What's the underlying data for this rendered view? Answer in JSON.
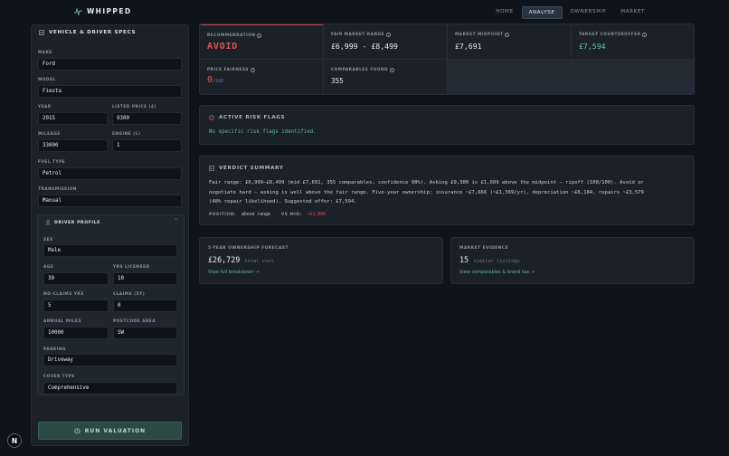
{
  "app": {
    "name": "WHIPPED"
  },
  "nav": [
    "HOME",
    "ANALYSE",
    "OWNERSHIP",
    "MARKET"
  ],
  "nav_active": "ANALYSE",
  "sidebar": {
    "title": "VEHICLE & DRIVER SPECS",
    "make": {
      "label": "MAKE",
      "value": "Ford"
    },
    "model": {
      "label": "MODEL",
      "value": "Fiesta"
    },
    "year": {
      "label": "YEAR",
      "value": "2015"
    },
    "listed_price": {
      "label": "LISTED PRICE (£)",
      "value": "9300"
    },
    "mileage": {
      "label": "MILEAGE",
      "value": "33000"
    },
    "engine": {
      "label": "ENGINE (L)",
      "value": "1"
    },
    "fuel_type": {
      "label": "FUEL TYPE",
      "value": "Petrol"
    },
    "transmission": {
      "label": "TRANSMISSION",
      "value": "Manual"
    },
    "driver_profile": {
      "title": "DRIVER PROFILE",
      "sex": {
        "label": "SEX",
        "value": "Male"
      },
      "age": {
        "label": "AGE",
        "value": "30"
      },
      "yrs_licensed": {
        "label": "YRS LICENSED",
        "value": "10"
      },
      "no_claims": {
        "label": "NO-CLAIMS YRS",
        "value": "5"
      },
      "claims": {
        "label": "CLAIMS (5Y)",
        "value": "0"
      },
      "annual_miles": {
        "label": "ANNUAL MILES",
        "value": "10000"
      },
      "postcode": {
        "label": "POSTCODE AREA",
        "value": "SW"
      },
      "parking": {
        "label": "PARKING",
        "value": "Driveway"
      },
      "cover_type": {
        "label": "COVER TYPE",
        "value": "Comprehensive"
      }
    },
    "run_button": "RUN VALUATION"
  },
  "summary": {
    "recommendation": {
      "label": "RECOMMENDATION",
      "value": "AVOID"
    },
    "fair_market_range": {
      "label": "FAIR MARKET RANGE",
      "value": "£6,999 - £8,499"
    },
    "market_midpoint": {
      "label": "MARKET MIDPOINT",
      "value": "£7,691"
    },
    "target_counteroffer": {
      "label": "TARGET COUNTEROFFER",
      "value": "£7,594"
    },
    "price_fairness": {
      "label": "PRICE FAIRNESS",
      "value": "0",
      "suffix": "/100"
    },
    "comparables_found": {
      "label": "COMPARABLES FOUND",
      "value": "355"
    }
  },
  "risk_flags": {
    "title": "ACTIVE RISK FLAGS",
    "text": "No specific risk flags identified."
  },
  "verdict": {
    "title": "VERDICT SUMMARY",
    "line1": "Fair range: £6,999–£8,499 (mid £7,691, 355 comparables, confidence 98%). Asking £9,300 is £1,609 above the midpoint — ripoff (100/100). Avoid or",
    "line2": "negotiate hard — asking is well above the fair range. Five-year ownership: insurance ~£7,666 (~£1,369/yr), depreciation ~£6,184, repairs ~£3,579",
    "line3": "(48% repair likelihood). Suggested offer: £7,594.",
    "position_label": "POSITION:",
    "position_value": "above range",
    "vs_mid_label": "VS MID:",
    "vs_mid_value": "+£1,609"
  },
  "forecast": {
    "label": "5-YEAR OWNERSHIP FORECAST",
    "value": "£26,729",
    "unit": "total cost",
    "link": "View full breakdown →"
  },
  "evidence": {
    "label": "MARKET EVIDENCE",
    "value": "15",
    "unit": "similar listings",
    "link": "View comparables & brand tax →"
  },
  "colors": {
    "accent_green": "#5fb6a0",
    "danger_red": "#e5534b",
    "teal_value": "#6cc4b0"
  },
  "corner_button": "N"
}
